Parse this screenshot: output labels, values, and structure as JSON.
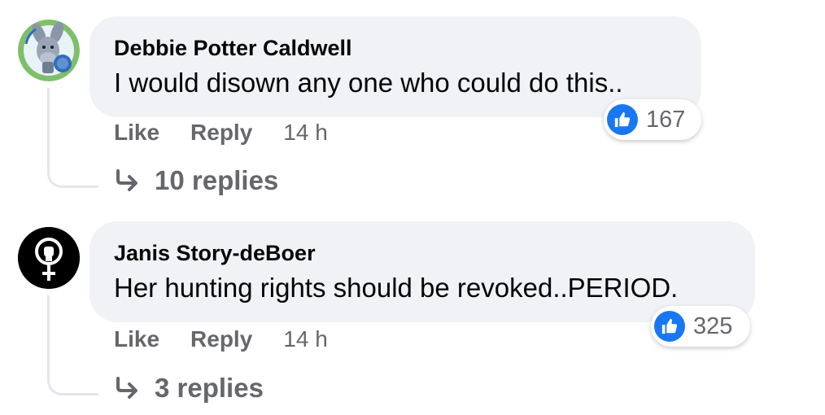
{
  "comments": [
    {
      "author": "Debbie Potter Caldwell",
      "text": "I would disown any one who could do this..",
      "reaction_count": "167",
      "actions": {
        "like": "Like",
        "reply": "Reply",
        "time": "14 h"
      },
      "replies": "10 replies",
      "avatar_icon": "eeyore-vaccine-avatar"
    },
    {
      "author": "Janis Story-deBoer",
      "text": "Her hunting rights should be revoked..PERIOD.",
      "reaction_count": "325",
      "actions": {
        "like": "Like",
        "reply": "Reply",
        "time": "14 h"
      },
      "replies": "3 replies",
      "avatar_icon": "female-fist-symbol-avatar"
    }
  ],
  "colors": {
    "bubble": "#f0f2f5",
    "like_blue": "#1877f2",
    "secondary_text": "#65676b",
    "primary_text": "#050505"
  }
}
